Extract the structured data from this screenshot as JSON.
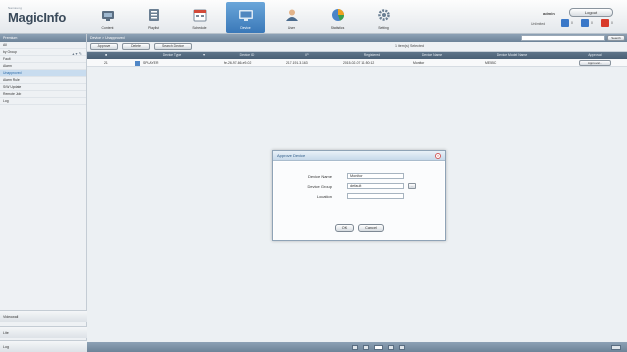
{
  "app": {
    "logo_small": "Samsung",
    "logo": "MagicInfo"
  },
  "nav": [
    {
      "label": "Content",
      "icon": "content-icon",
      "active": false
    },
    {
      "label": "Playlist",
      "icon": "playlist-icon",
      "active": false
    },
    {
      "label": "Schedule",
      "icon": "schedule-icon",
      "active": false
    },
    {
      "label": "Device",
      "icon": "device-icon",
      "active": true
    },
    {
      "label": "User",
      "icon": "user-icon",
      "active": false
    },
    {
      "label": "Statistics",
      "icon": "statistics-icon",
      "active": false
    },
    {
      "label": "Setting",
      "icon": "setting-icon",
      "active": false
    }
  ],
  "user": {
    "name": "admin",
    "logout": "Logout",
    "unlimited": "Unlimited",
    "badges": [
      {
        "value": "0",
        "color": "#3a78c8"
      },
      {
        "value": "0",
        "color": "#3a78c8"
      },
      {
        "value": "0",
        "color": "#d83a2a"
      }
    ]
  },
  "sidebar": {
    "header": "Premium",
    "items": [
      {
        "label": "All"
      },
      {
        "label": "by Group"
      },
      {
        "label": "Fault"
      },
      {
        "label": "Alarm"
      },
      {
        "label": "Unapproved"
      },
      {
        "label": "Alarm Rule"
      },
      {
        "label": "S/W Update"
      },
      {
        "label": "Remote Job"
      },
      {
        "label": "Log"
      }
    ],
    "bottom": [
      "Videowall",
      "Lite",
      "Log"
    ]
  },
  "main": {
    "crumb": "Device > Unapproved",
    "search_placeholder": "",
    "search_btn": "Search",
    "toolbar": {
      "approve": "Approve",
      "delete": "Delete",
      "search_device": "Search Device",
      "selected": "1 item(s) Selected"
    },
    "columns": [
      "",
      "Device Type",
      "Device ID",
      "IP",
      "Registered",
      "Device Name",
      "Device Model Name",
      "Approval"
    ],
    "rows": [
      {
        "index": "21",
        "device_type": "SPLAYER",
        "device_id": "fe-26-97-66-e9-02",
        "ip": "217.191.3.163",
        "registered": "2015-02-07 11:50:12",
        "device_name": "Monitor",
        "model": "ME55C",
        "action": "Approval..."
      }
    ]
  },
  "modal": {
    "title": "Approve Device",
    "device_name_label": "Device Name",
    "device_name_value": "Monitor",
    "device_group_label": "Device Group",
    "device_group_value": "default",
    "location_label": "Location",
    "location_value": "",
    "ok": "OK",
    "cancel": "Cancel"
  }
}
